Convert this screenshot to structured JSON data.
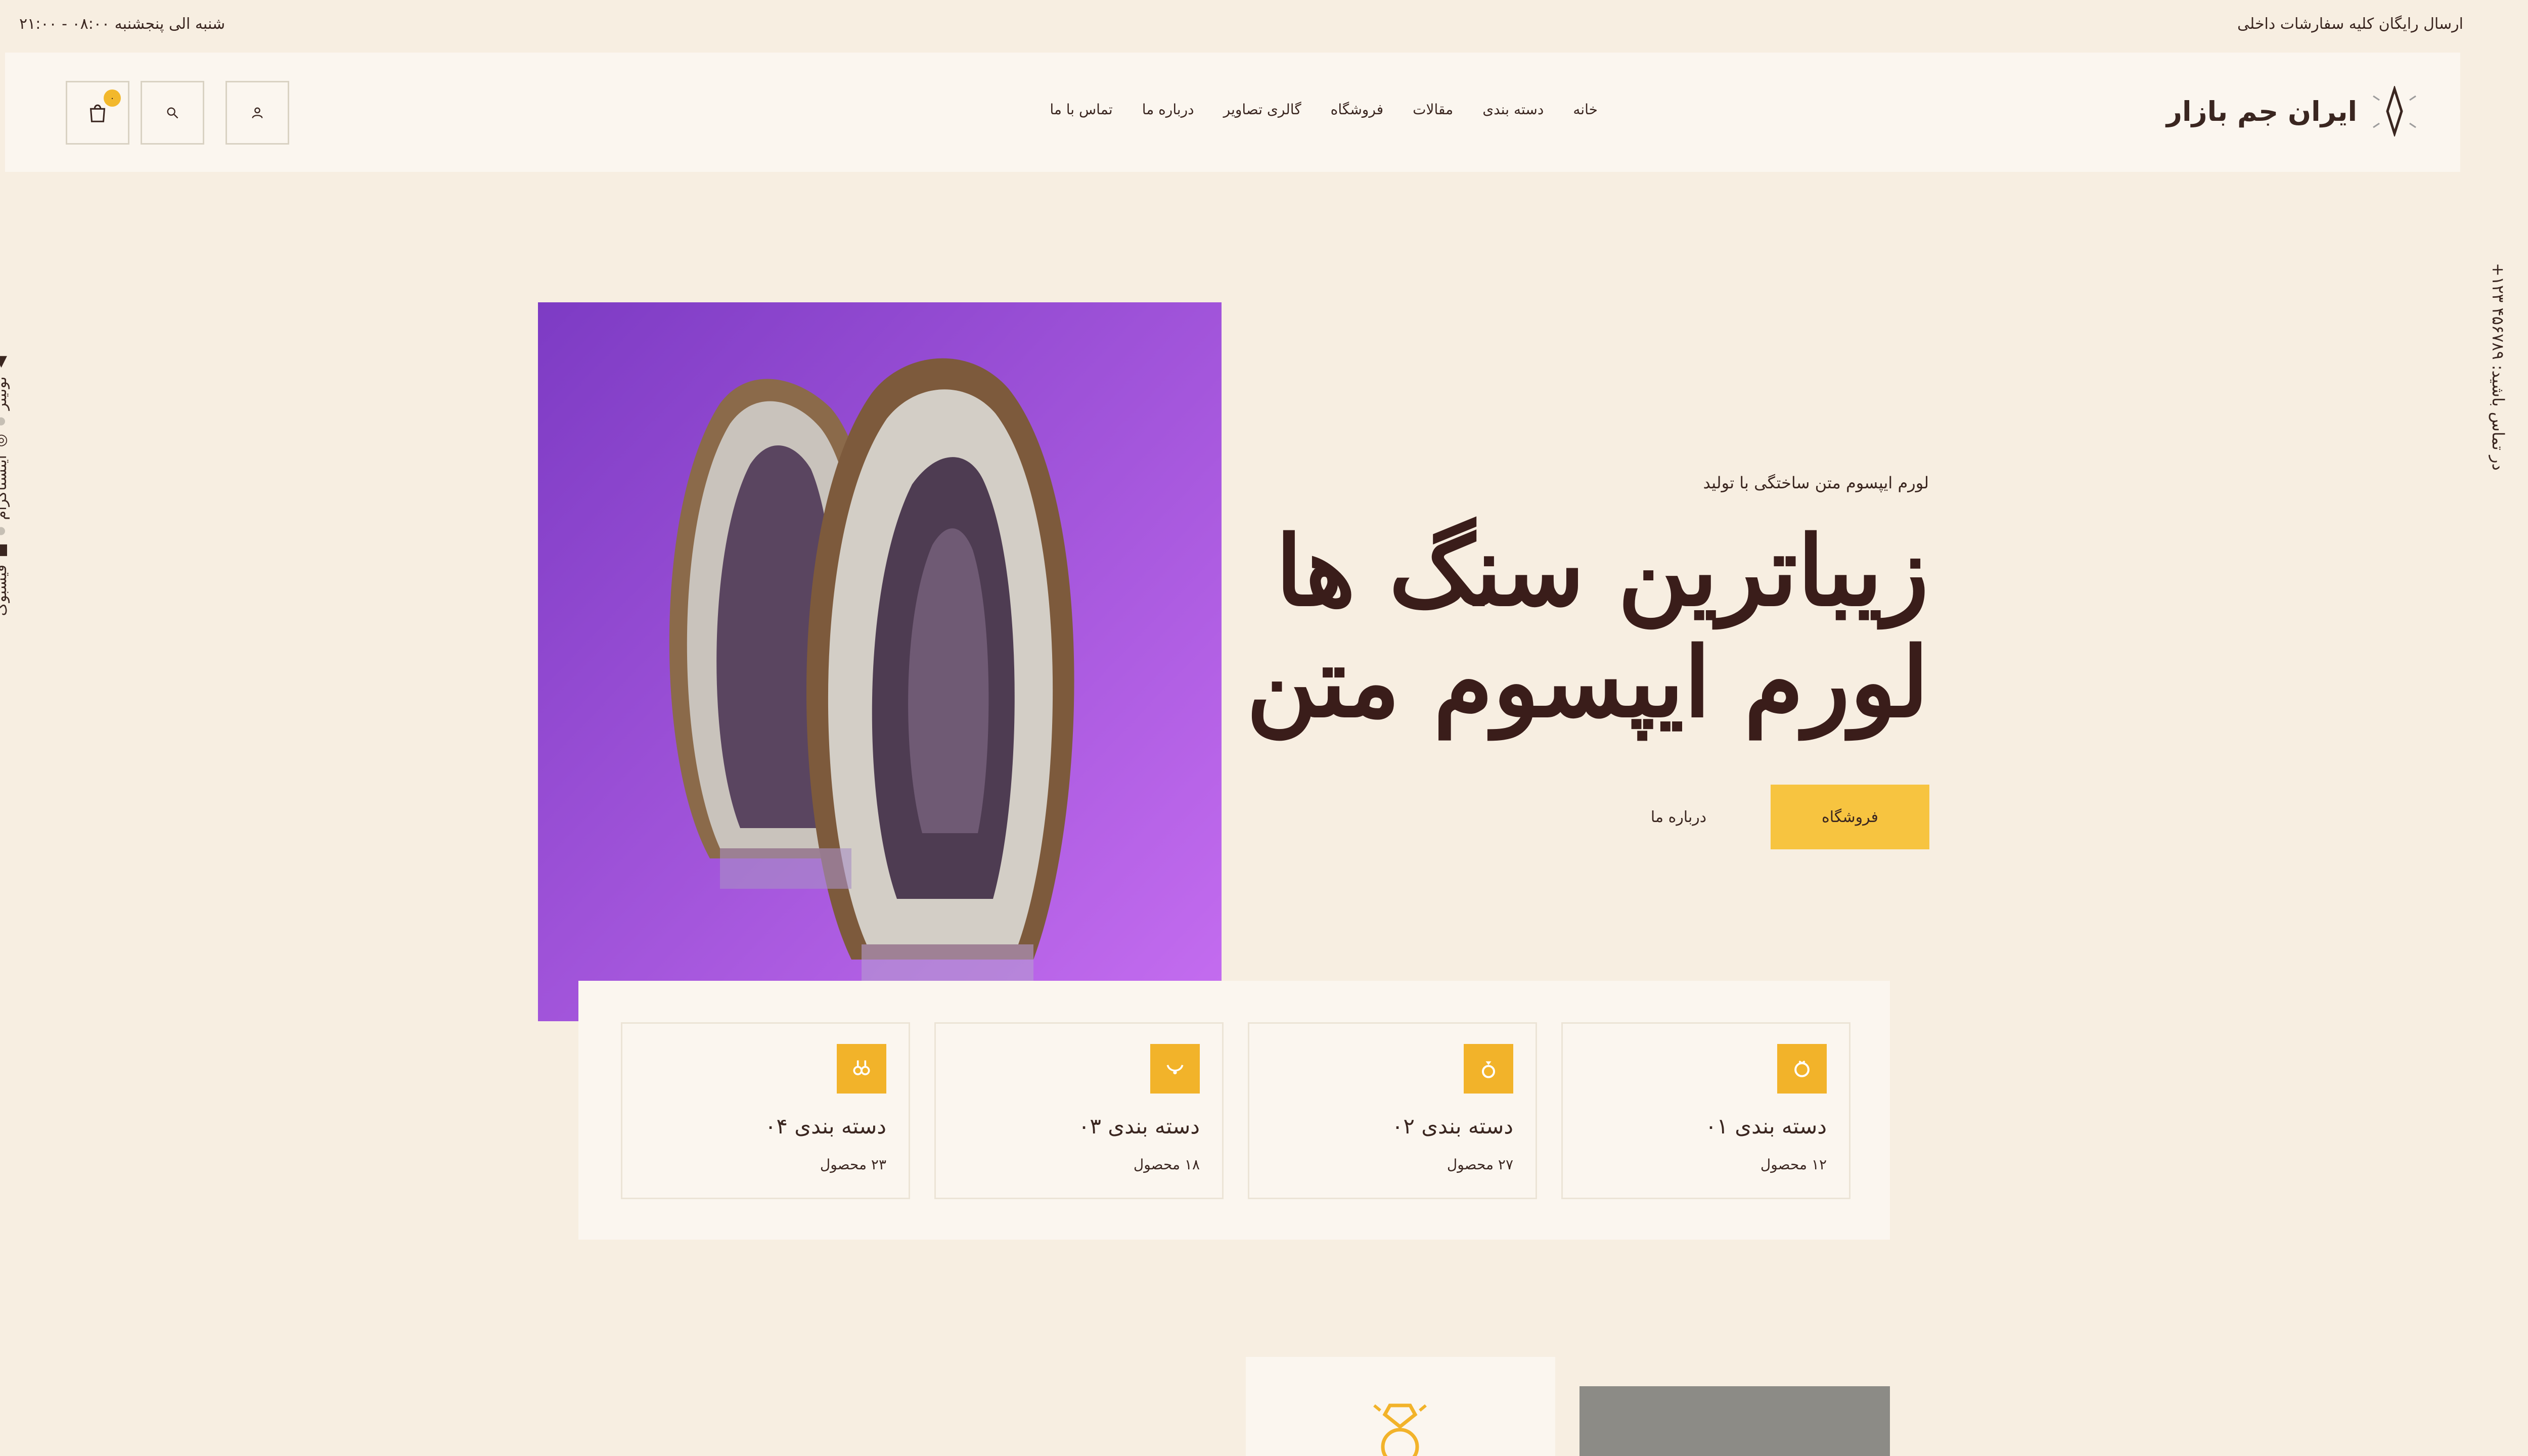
{
  "topbar": {
    "shipping": "ارسال رایگان کلیه سفارشات داخلی",
    "hours": "شنبه الی پنجشنبه ۰۸:۰۰ - ۲۱:۰۰"
  },
  "header": {
    "logo": "ایران جم بازار",
    "nav": [
      "خانه",
      "دسته بندی",
      "مقالات",
      "فروشگاه",
      "گالری تصاویر",
      "درباره ما",
      "تماس با ما"
    ],
    "cart_count": "۰"
  },
  "side": {
    "social": [
      "فیسبوک",
      "اینستاگرام",
      "توئیتر"
    ],
    "phone": "در تماس باشید: ۴۵۶۷۸۹ ۱۲۳+"
  },
  "hero": {
    "subtitle": "لورم ایپسوم متن ساختگی با تولید",
    "title_line1": "زیباترین سنگ ها",
    "title_line2": "لورم ایپسوم متن",
    "shop_button": "فروشگاه",
    "about_button": "درباره ما"
  },
  "categories": [
    {
      "title": "دسته بندی ۰۱",
      "count": "۱۲ محصول",
      "icon": "ring-icon"
    },
    {
      "title": "دسته بندی ۰۲",
      "count": "۲۷ محصول",
      "icon": "gem-ring-icon"
    },
    {
      "title": "دسته بندی ۰۳",
      "count": "۱۸ محصول",
      "icon": "necklace-icon"
    },
    {
      "title": "دسته بندی ۰۴",
      "count": "۲۳ محصول",
      "icon": "earrings-icon"
    }
  ],
  "colors": {
    "background": "#f7eee1",
    "panel": "#fbf6ef",
    "accent": "#f2b32a",
    "text": "#3a2620",
    "hero_image_bg": "#9b4fd6"
  }
}
